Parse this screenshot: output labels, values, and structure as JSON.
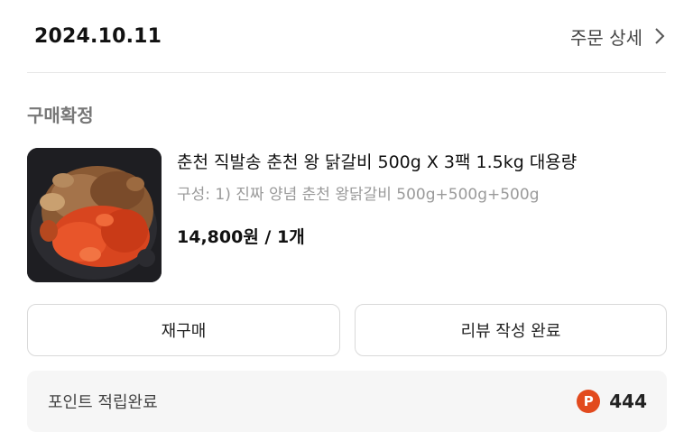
{
  "order": {
    "date": "2024.10.11",
    "detail_link_label": "주문 상세",
    "status": "구매확정"
  },
  "product": {
    "image_icon": "food-photo",
    "name": "춘천 직발송 춘천 왕 닭갈비 500g X 3팩 1.5kg 대용량",
    "option": "구성: 1) 진짜 양념 춘천 왕닭갈비 500g+500g+500g",
    "price": "14,800원 / 1개"
  },
  "actions": {
    "rebuy_label": "재구매",
    "review_label": "리뷰 작성 완료"
  },
  "points": {
    "label": "포인트 적립완료",
    "badge": "P",
    "value": "444",
    "badge_color": "#e24a1e"
  }
}
